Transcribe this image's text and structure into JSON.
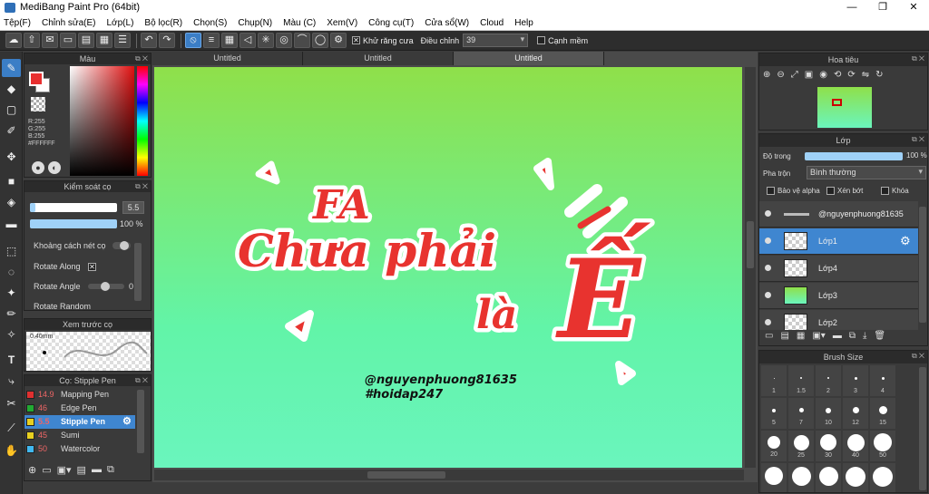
{
  "window": {
    "title": "MediBang Paint Pro (64bit)",
    "minimize": "—",
    "restore": "❐",
    "close": "✕"
  },
  "menu": [
    "Tệp(F)",
    "Chỉnh sửa(E)",
    "Lớp(L)",
    "Bộ lọc(R)",
    "Chọn(S)",
    "Chụp(N)",
    "Màu (C)",
    "Xem(V)",
    "Công cụ(T)",
    "Cửa sổ(W)",
    "Cloud",
    "Help"
  ],
  "toolbar": {
    "antialias_label": "Khử răng cưa",
    "correction_label": "Điều chỉnh",
    "correction_value": "39",
    "edge_label": "Cạnh mềm"
  },
  "tabs": [
    "Untitled",
    "Untitled",
    "Untitled"
  ],
  "color_panel": {
    "title": "Màu",
    "r": "R:255",
    "g": "G:255",
    "b": "B:255",
    "hex": "#FFFFFF"
  },
  "brush_control": {
    "title": "Kiểm soát cọ",
    "size": "5.5",
    "opacity": "100 %",
    "opt1": "Khoảng cách nét cọ",
    "opt2": "Rotate Along",
    "opt3": "Rotate Angle",
    "opt3_val": "0",
    "opt4": "Rotate Random"
  },
  "preview": {
    "title": "Xem trước cọ",
    "size": "0.40mm"
  },
  "brush_list": {
    "title": "Cọ: Stipple Pen",
    "items": [
      {
        "size": "14.9",
        "name": "Mapping Pen",
        "color": "#e03030"
      },
      {
        "size": "46",
        "name": "Edge Pen",
        "color": "#22aa33"
      },
      {
        "size": "5.5",
        "name": "Stipple Pen",
        "color": "#e8d020"
      },
      {
        "size": "45",
        "name": "Sumi",
        "color": "#e8d020"
      },
      {
        "size": "50",
        "name": "Watercolor",
        "color": "#40b8f0"
      }
    ]
  },
  "canvas_text": {
    "l1": "FA",
    "l2": "Chưa phải",
    "l3": "là",
    "big": "Ế",
    "credit1": "@nguyenphuong81635",
    "credit2": "#hoidap247"
  },
  "navigator": {
    "title": "Hoa tiêu"
  },
  "layers": {
    "title": "Lớp",
    "opacity_label": "Độ trong",
    "opacity_value": "100 %",
    "blend_label": "Pha trộn",
    "blend_value": "Bình thường",
    "protect_alpha": "Bảo vệ alpha",
    "clipping": "Xén bớt",
    "lock": "Khóa",
    "items": [
      "@nguyenphuong81635",
      "Lớp1",
      "Lớp4",
      "Lớp3",
      "Lớp2"
    ]
  },
  "brush_size": {
    "title": "Brush Size",
    "rows": [
      [
        "1",
        "1.5",
        "2",
        "3",
        "4"
      ],
      [
        "5",
        "7",
        "10",
        "12",
        "15"
      ],
      [
        "20",
        "25",
        "30",
        "40",
        "50"
      ]
    ]
  },
  "colors": {
    "accent": "#3f86d0",
    "canvas_top": "#8fe04a",
    "canvas_bottom": "#6af5bd",
    "letter_red": "#e8332f"
  }
}
